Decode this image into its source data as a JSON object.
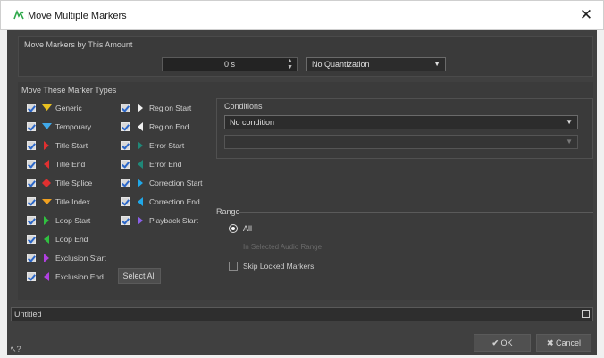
{
  "window": {
    "title": "Move Multiple Markers",
    "close": "✕"
  },
  "move_amount": {
    "heading": "Move Markers by This Amount",
    "offset_value": "0 s",
    "quantization": "No Quantization"
  },
  "marker_types": {
    "heading": "Move These Marker Types",
    "left_column": [
      {
        "label": "Generic",
        "icon": "generic-marker-icon",
        "color": "#e8c020"
      },
      {
        "label": "Temporary",
        "icon": "temporary-marker-icon",
        "color": "#40a8e8"
      },
      {
        "label": "Title Start",
        "icon": "title-start-icon",
        "color": "#e03030"
      },
      {
        "label": "Title End",
        "icon": "title-end-icon",
        "color": "#e03030"
      },
      {
        "label": "Title Splice",
        "icon": "title-splice-icon",
        "color": "#e03030"
      },
      {
        "label": "Title Index",
        "icon": "title-index-icon",
        "color": "#f0a020"
      },
      {
        "label": "Loop Start",
        "icon": "loop-start-icon",
        "color": "#30c040"
      },
      {
        "label": "Loop End",
        "icon": "loop-end-icon",
        "color": "#30c040"
      },
      {
        "label": "Exclusion Start",
        "icon": "exclusion-start-icon",
        "color": "#b040e0"
      },
      {
        "label": "Exclusion End",
        "icon": "exclusion-end-icon",
        "color": "#b040e0"
      }
    ],
    "right_column": [
      {
        "label": "Region Start",
        "icon": "region-start-icon",
        "color": "#f0f0f0"
      },
      {
        "label": "Region End",
        "icon": "region-end-icon",
        "color": "#f0f0f0"
      },
      {
        "label": "Error Start",
        "icon": "error-start-icon",
        "color": "#208878"
      },
      {
        "label": "Error End",
        "icon": "error-end-icon",
        "color": "#208878"
      },
      {
        "label": "Correction Start",
        "icon": "correction-start-icon",
        "color": "#20a8e8"
      },
      {
        "label": "Correction End",
        "icon": "correction-end-icon",
        "color": "#20a8e8"
      },
      {
        "label": "Playback Start",
        "icon": "playback-start-icon",
        "color": "#8a60e8"
      }
    ],
    "select_all": "Select All"
  },
  "conditions": {
    "heading": "Conditions",
    "condition": "No condition",
    "secondary": ""
  },
  "range": {
    "heading": "Range",
    "all": "All",
    "in_selected": "In Selected Audio Range",
    "skip_locked": "Skip Locked Markers"
  },
  "preset": {
    "name": "Untitled"
  },
  "buttons": {
    "ok": "OK",
    "cancel": "Cancel"
  },
  "help": "?"
}
